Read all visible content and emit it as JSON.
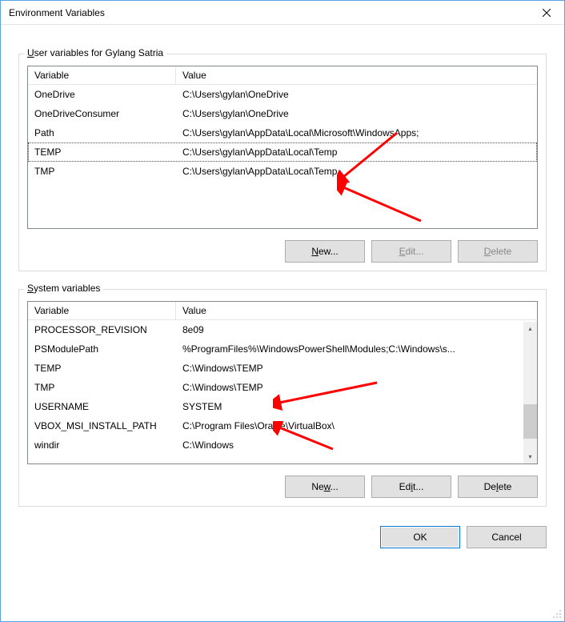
{
  "window": {
    "title": "Environment Variables"
  },
  "userGroup": {
    "label_prefix": "U",
    "label_rest": "ser variables for Gylang Satria",
    "headers": {
      "variable": "Variable",
      "value": "Value"
    },
    "rows": [
      {
        "name": "OneDrive",
        "value": "C:\\Users\\gylan\\OneDrive"
      },
      {
        "name": "OneDriveConsumer",
        "value": "C:\\Users\\gylan\\OneDrive"
      },
      {
        "name": "Path",
        "value": "C:\\Users\\gylan\\AppData\\Local\\Microsoft\\WindowsApps;"
      },
      {
        "name": "TEMP",
        "value": "C:\\Users\\gylan\\AppData\\Local\\Temp"
      },
      {
        "name": "TMP",
        "value": "C:\\Users\\gylan\\AppData\\Local\\Temp"
      }
    ],
    "selectedIndex": 3,
    "buttons": {
      "new_prefix": "N",
      "new_rest": "ew...",
      "edit_prefix": "E",
      "edit_rest": "dit...",
      "delete_prefix": "D",
      "delete_rest": "elete"
    }
  },
  "systemGroup": {
    "label_prefix": "S",
    "label_rest": "ystem variables",
    "headers": {
      "variable": "Variable",
      "value": "Value"
    },
    "rows": [
      {
        "name": "PROCESSOR_REVISION",
        "value": "8e09"
      },
      {
        "name": "PSModulePath",
        "value": "%ProgramFiles%\\WindowsPowerShell\\Modules;C:\\Windows\\s..."
      },
      {
        "name": "TEMP",
        "value": "C:\\Windows\\TEMP"
      },
      {
        "name": "TMP",
        "value": "C:\\Windows\\TEMP"
      },
      {
        "name": "USERNAME",
        "value": "SYSTEM"
      },
      {
        "name": "VBOX_MSI_INSTALL_PATH",
        "value": "C:\\Program Files\\Oracle\\VirtualBox\\"
      },
      {
        "name": "windir",
        "value": "C:\\Windows"
      }
    ],
    "buttons": {
      "new_prefix": "w",
      "new_pre": "Ne",
      "new_rest": "...",
      "edit_prefix": "i",
      "edit_pre": "Ed",
      "edit_rest": "t...",
      "delete_prefix": "l",
      "delete_pre": "De",
      "delete_rest": "ete"
    }
  },
  "footer": {
    "ok": "OK",
    "cancel": "Cancel"
  }
}
